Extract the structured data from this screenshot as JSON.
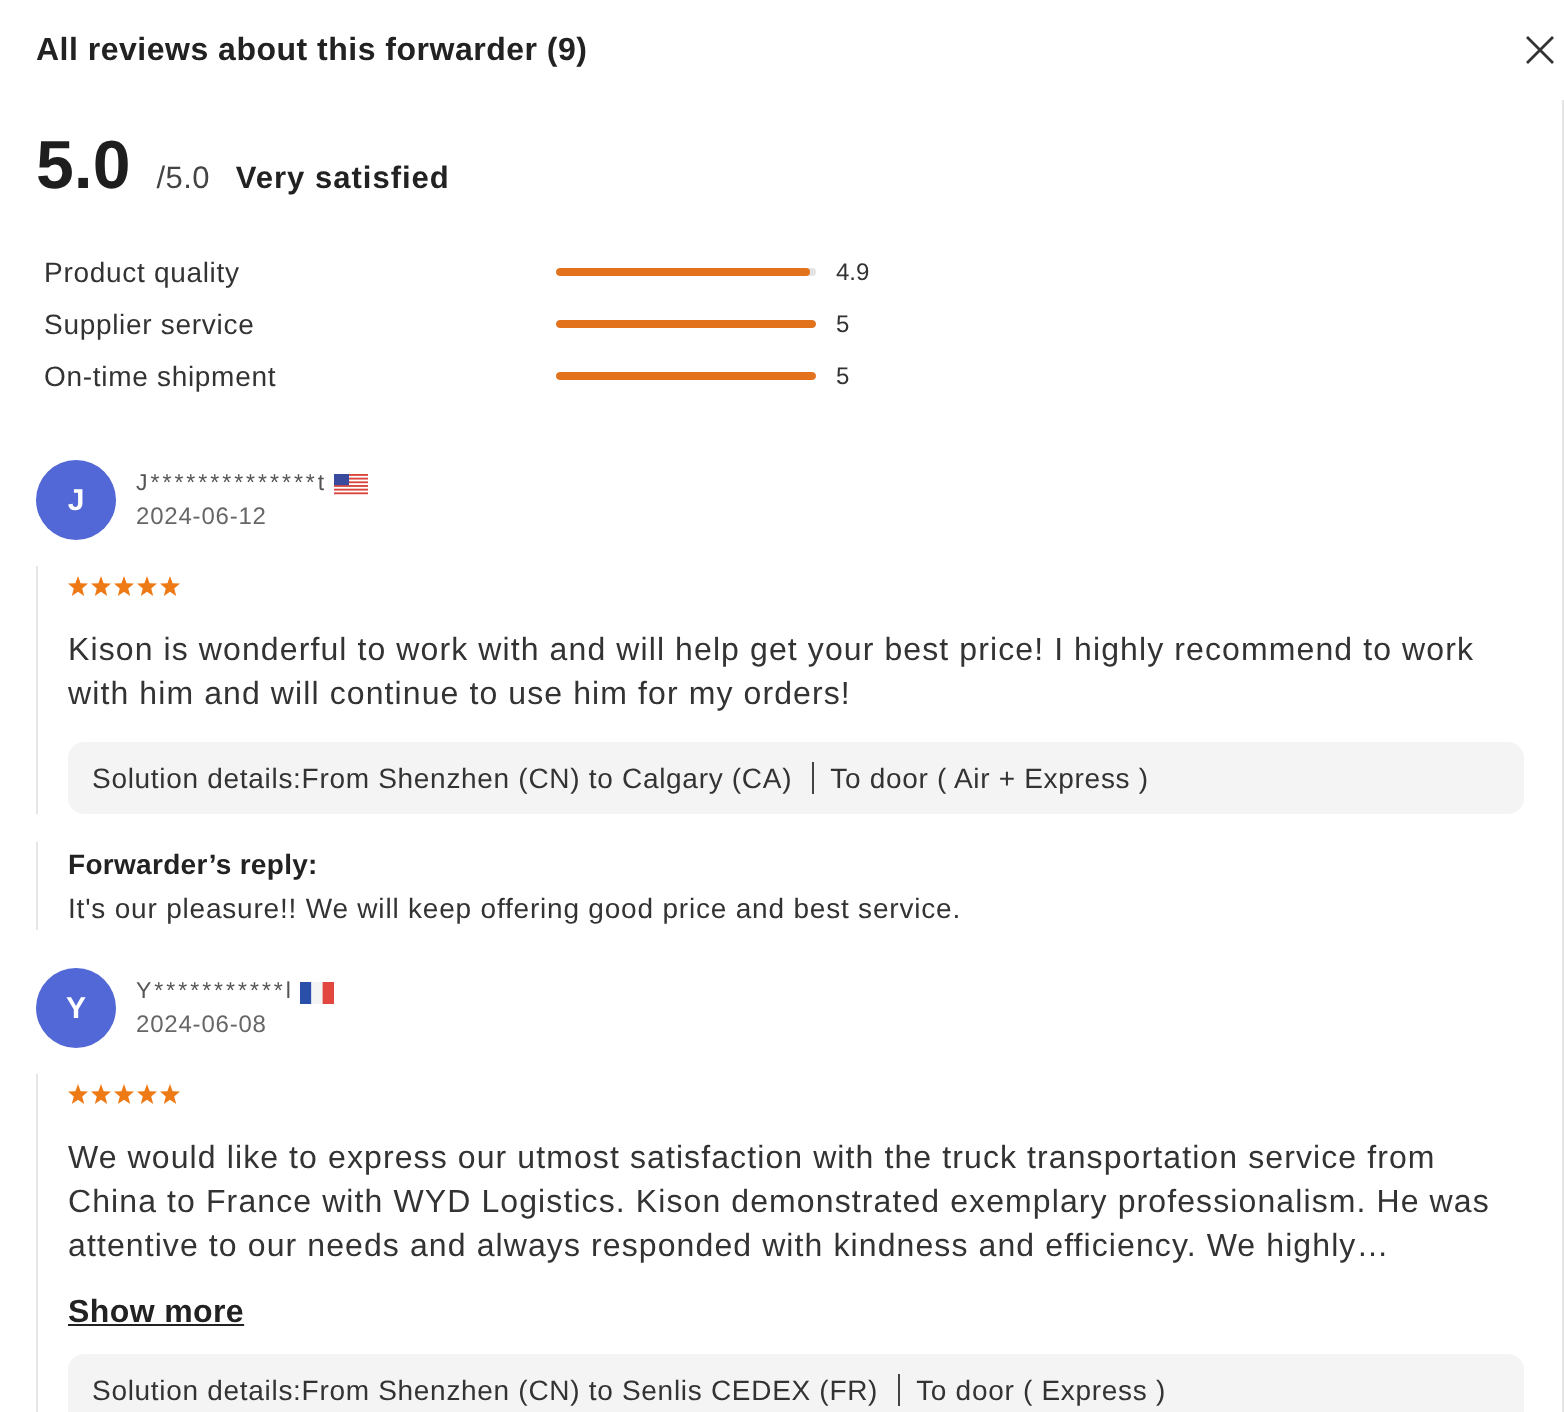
{
  "dialog": {
    "title": "All reviews about this forwarder (9)"
  },
  "summary": {
    "score": "5.0",
    "out_of": "/5.0",
    "verdict": "Very satisfied"
  },
  "ratings": [
    {
      "label": "Product quality",
      "level": 0.98,
      "reading": "4.9"
    },
    {
      "label": "Supplier service",
      "level": 1,
      "reading": "5"
    },
    {
      "label": "On-time shipment",
      "level": 1,
      "reading": "5"
    }
  ],
  "reviews": [
    {
      "initial": "J",
      "name": "J**************t",
      "flag": {
        "kind": "us"
      },
      "date": "2024-06-12",
      "stars": 5,
      "text": "Kison is wonderful to work with and will help get your best price! I highly recommend to work with him and will continue to use him for my orders!",
      "solution": {
        "route": "Solution details:From Shenzhen (CN) to Calgary (CA)",
        "mode": "To door ( Air + Express )"
      },
      "reply": {
        "heading": "Forwarder’s reply:",
        "text": "It's our pleasure!! We will keep offering good price and best service."
      }
    },
    {
      "initial": "Y",
      "name": "Y***********l",
      "flag": {
        "kind": "fr"
      },
      "date": "2024-06-08",
      "stars": 5,
      "text": "We would like to express our utmost satisfaction with the truck transportation service from China to France with WYD Logistics. Kison demonstrated exemplary professionalism. He was attentive to our needs and always responded with kindness and efficiency. We highly…",
      "show_more": "Show more",
      "solution": {
        "route": "Solution details:From Shenzhen (CN) to Senlis CEDEX (FR)",
        "mode": "To door ( Express )"
      }
    }
  ]
}
